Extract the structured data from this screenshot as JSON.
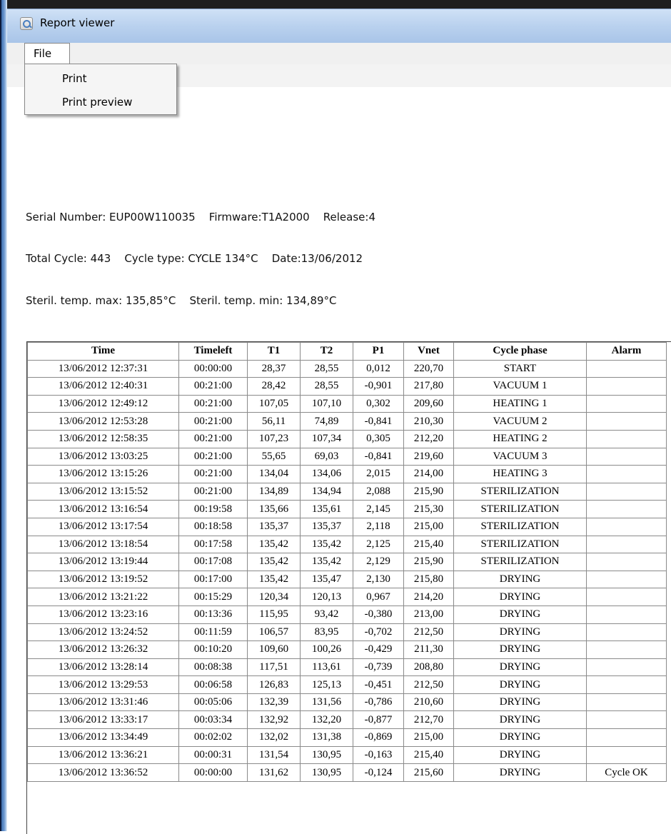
{
  "window": {
    "title": "Report viewer"
  },
  "menu": {
    "file_label": "File",
    "items": [
      "Print",
      "Print preview"
    ]
  },
  "info": {
    "line1": "Serial Number: EUP00W110035    Firmware:T1A2000    Release:4",
    "line2": "Total Cycle: 443    Cycle type: CYCLE 134°C    Date:13/06/2012",
    "line3": "Steril. temp. max: 135,85°C    Steril. temp. min: 134,89°C"
  },
  "table": {
    "headers": [
      "Time",
      "Timeleft",
      "T1",
      "T2",
      "P1",
      "Vnet",
      "Cycle phase",
      "Alarm"
    ],
    "rows": [
      [
        "13/06/2012 12:37:31",
        "00:00:00",
        "28,37",
        "28,55",
        "0,012",
        "220,70",
        "START",
        ""
      ],
      [
        "13/06/2012 12:40:31",
        "00:21:00",
        "28,42",
        "28,55",
        "-0,901",
        "217,80",
        "VACUUM 1",
        ""
      ],
      [
        "13/06/2012 12:49:12",
        "00:21:00",
        "107,05",
        "107,10",
        "0,302",
        "209,60",
        "HEATING 1",
        ""
      ],
      [
        "13/06/2012 12:53:28",
        "00:21:00",
        "56,11",
        "74,89",
        "-0,841",
        "210,30",
        "VACUUM 2",
        ""
      ],
      [
        "13/06/2012 12:58:35",
        "00:21:00",
        "107,23",
        "107,34",
        "0,305",
        "212,20",
        "HEATING 2",
        ""
      ],
      [
        "13/06/2012 13:03:25",
        "00:21:00",
        "55,65",
        "69,03",
        "-0,841",
        "219,60",
        "VACUUM 3",
        ""
      ],
      [
        "13/06/2012 13:15:26",
        "00:21:00",
        "134,04",
        "134,06",
        "2,015",
        "214,00",
        "HEATING 3",
        ""
      ],
      [
        "13/06/2012 13:15:52",
        "00:21:00",
        "134,89",
        "134,94",
        "2,088",
        "215,90",
        "STERILIZATION",
        ""
      ],
      [
        "13/06/2012 13:16:54",
        "00:19:58",
        "135,66",
        "135,61",
        "2,145",
        "215,30",
        "STERILIZATION",
        ""
      ],
      [
        "13/06/2012 13:17:54",
        "00:18:58",
        "135,37",
        "135,37",
        "2,118",
        "215,00",
        "STERILIZATION",
        ""
      ],
      [
        "13/06/2012 13:18:54",
        "00:17:58",
        "135,42",
        "135,42",
        "2,125",
        "215,40",
        "STERILIZATION",
        ""
      ],
      [
        "13/06/2012 13:19:44",
        "00:17:08",
        "135,42",
        "135,42",
        "2,129",
        "215,90",
        "STERILIZATION",
        ""
      ],
      [
        "13/06/2012 13:19:52",
        "00:17:00",
        "135,42",
        "135,47",
        "2,130",
        "215,80",
        "DRYING",
        ""
      ],
      [
        "13/06/2012 13:21:22",
        "00:15:29",
        "120,34",
        "120,13",
        "0,967",
        "214,20",
        "DRYING",
        ""
      ],
      [
        "13/06/2012 13:23:16",
        "00:13:36",
        "115,95",
        "93,42",
        "-0,380",
        "213,00",
        "DRYING",
        ""
      ],
      [
        "13/06/2012 13:24:52",
        "00:11:59",
        "106,57",
        "83,95",
        "-0,702",
        "212,50",
        "DRYING",
        ""
      ],
      [
        "13/06/2012 13:26:32",
        "00:10:20",
        "109,60",
        "100,26",
        "-0,429",
        "211,30",
        "DRYING",
        ""
      ],
      [
        "13/06/2012 13:28:14",
        "00:08:38",
        "117,51",
        "113,61",
        "-0,739",
        "208,80",
        "DRYING",
        ""
      ],
      [
        "13/06/2012 13:29:53",
        "00:06:58",
        "126,83",
        "125,13",
        "-0,451",
        "212,50",
        "DRYING",
        ""
      ],
      [
        "13/06/2012 13:31:46",
        "00:05:06",
        "132,39",
        "131,56",
        "-0,786",
        "210,60",
        "DRYING",
        ""
      ],
      [
        "13/06/2012 13:33:17",
        "00:03:34",
        "132,92",
        "132,20",
        "-0,877",
        "212,70",
        "DRYING",
        ""
      ],
      [
        "13/06/2012 13:34:49",
        "00:02:02",
        "132,02",
        "131,38",
        "-0,869",
        "215,00",
        "DRYING",
        ""
      ],
      [
        "13/06/2012 13:36:21",
        "00:00:31",
        "131,54",
        "130,95",
        "-0,163",
        "215,40",
        "DRYING",
        ""
      ],
      [
        "13/06/2012 13:36:52",
        "00:00:00",
        "131,62",
        "130,95",
        "-0,124",
        "215,60",
        "DRYING",
        "Cycle OK"
      ]
    ]
  }
}
